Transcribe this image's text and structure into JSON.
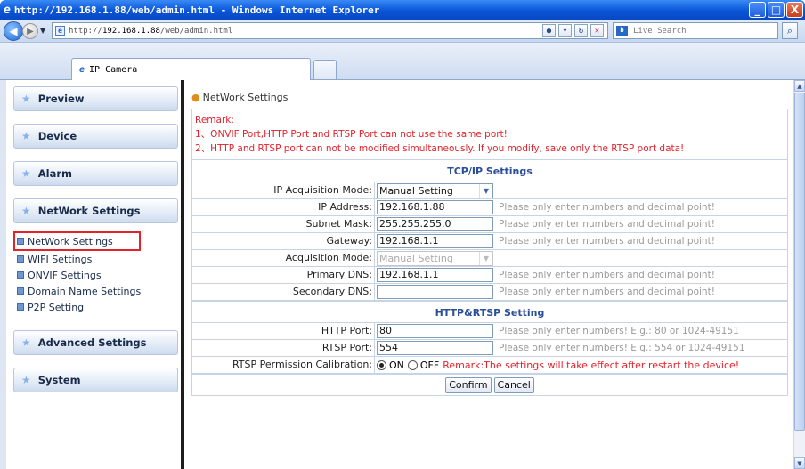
{
  "window": {
    "title": "http://192.168.1.88/web/admin.html - Windows Internet Explorer",
    "minimize": "_",
    "maximize": "□",
    "close": "X"
  },
  "address_bar": {
    "url_prefix": "http://",
    "url_host": "192.168.1.88",
    "url_path": "/web/admin.html",
    "search_placeholder": "Live Search"
  },
  "tab": {
    "label": "IP Camera"
  },
  "sidebar": {
    "menus": [
      {
        "label": "Preview"
      },
      {
        "label": "Device"
      },
      {
        "label": "Alarm"
      },
      {
        "label": "NetWork Settings"
      },
      {
        "label": "Advanced Settings"
      },
      {
        "label": "System"
      }
    ],
    "submenu": [
      {
        "label": "NetWork Settings",
        "selected": true
      },
      {
        "label": "WIFI Settings"
      },
      {
        "label": "ONVIF Settings"
      },
      {
        "label": "Domain Name Settings"
      },
      {
        "label": "P2P Setting"
      }
    ]
  },
  "content": {
    "breadcrumb": "NetWork Settings",
    "remark": {
      "title": "Remark:",
      "line1": "1、ONVIF Port,HTTP Port and RTSP Port can not use the same port!",
      "line2": "2、HTTP and RTSP port can not be modified simultaneously. If you modify, save only the RTSP port data!"
    },
    "tcpip": {
      "heading": "TCP/IP Settings",
      "ip_mode_label": "IP Acquisition Mode:",
      "ip_mode_value": "Manual Setting",
      "ip_label": "IP Address:",
      "ip_value": "192.168.1.88",
      "subnet_label": "Subnet Mask:",
      "subnet_value": "255.255.255.0",
      "gateway_label": "Gateway:",
      "gateway_value": "192.168.1.1",
      "acq_mode_label": "Acquisition Mode:",
      "acq_mode_value": "Manual Setting",
      "dns1_label": "Primary DNS:",
      "dns1_value": "192.168.1.1",
      "dns2_label": "Secondary DNS:",
      "dns2_value": "",
      "hint": "Please only enter numbers and decimal point!"
    },
    "http_rtsp": {
      "heading": "HTTP&RTSP Setting",
      "http_label": "HTTP Port:",
      "http_value": "80",
      "http_hint": "Please only enter numbers! E.g.: 80 or 1024-49151",
      "rtsp_label": "RTSP Port:",
      "rtsp_value": "554",
      "rtsp_hint": "Please only enter numbers! E.g.: 554 or 1024-49151",
      "perm_label": "RTSP Permission Calibration:",
      "on_label": "ON",
      "off_label": "OFF",
      "perm_remark": "Remark:The settings will take effect after restart the device!"
    },
    "buttons": {
      "confirm": "Confirm",
      "cancel": "Cancel"
    }
  },
  "colors": {
    "remark": "#e2232c",
    "heading": "#2b4f9a",
    "hint": "#9a9a9a"
  }
}
